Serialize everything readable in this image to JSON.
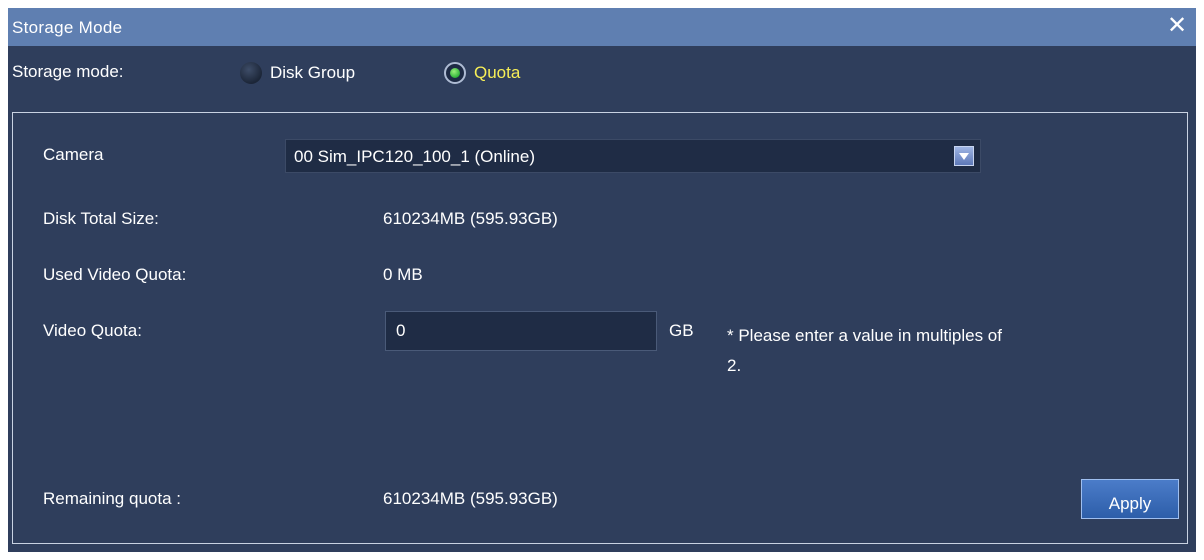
{
  "window": {
    "title": "Storage Mode",
    "close_symbol": "✕"
  },
  "storage_mode": {
    "label": "Storage mode:",
    "options": [
      {
        "label": "Disk Group",
        "selected": false
      },
      {
        "label": "Quota",
        "selected": true
      }
    ]
  },
  "quota_panel": {
    "camera_label": "Camera",
    "camera_selected": "00 Sim_IPC120_100_1 (Online)",
    "disk_total_label": "Disk Total Size:",
    "disk_total_value": "610234MB (595.93GB)",
    "used_quota_label": "Used Video Quota:",
    "used_quota_value": "0 MB",
    "video_quota_label": "Video Quota:",
    "video_quota_value": "0",
    "video_quota_unit": "GB",
    "note": "* Please enter a value in multiples of 2.",
    "remaining_label": "Remaining quota :",
    "remaining_value": "610234MB (595.93GB)",
    "apply_label": "Apply"
  },
  "colors": {
    "background": "#2f3e5c",
    "titlebar": "#5f7fb1",
    "selected_option_text": "#f7ef57",
    "radio_on": "#2eb23a",
    "apply_button": "#3a6cb9"
  }
}
